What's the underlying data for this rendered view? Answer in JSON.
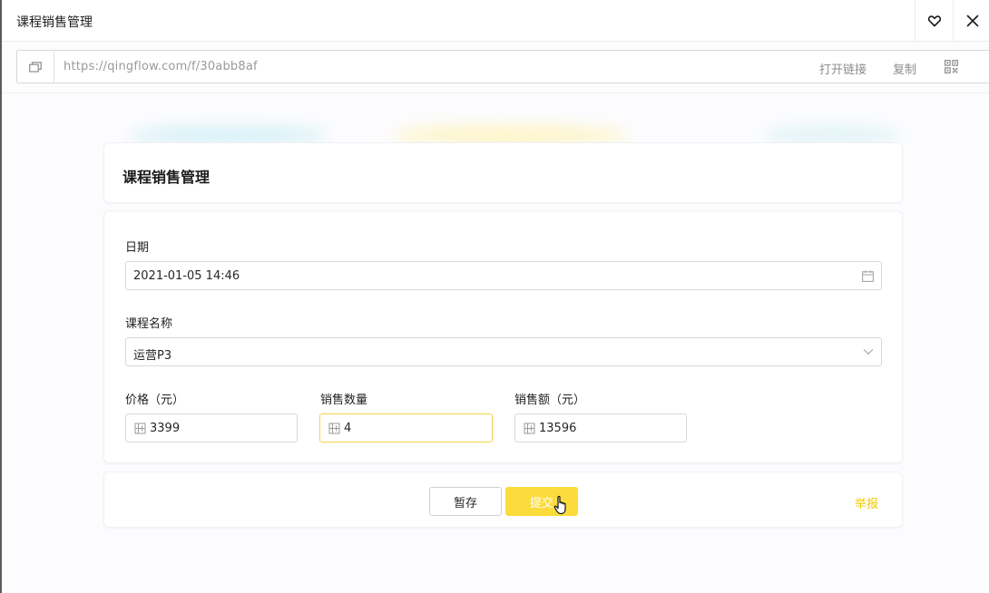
{
  "window": {
    "title": "课程销售管理"
  },
  "url_bar": {
    "url": "https://qingflow.com/f/30abb8af",
    "open_link_label": "打开链接",
    "copy_label": "复制"
  },
  "form": {
    "title": "课程销售管理",
    "fields": {
      "date": {
        "label": "日期",
        "value": "2021-01-05 14:46"
      },
      "course_name": {
        "label": "课程名称",
        "value": "运营P3"
      },
      "price": {
        "label": "价格（元）",
        "value": "3399"
      },
      "quantity": {
        "label": "销售数量",
        "value": "4"
      },
      "amount": {
        "label": "销售额（元）",
        "value": "13596"
      }
    }
  },
  "actions": {
    "save_label": "暂存",
    "submit_label": "提交",
    "report_label": "举报"
  },
  "colors": {
    "accent": "#fbdc3c",
    "report": "#f0c800"
  },
  "icons": [
    "heart-icon",
    "close-icon",
    "window-icon",
    "qr-code-icon",
    "calendar-icon",
    "chevron-down-icon",
    "number-icon",
    "hand-cursor-icon"
  ]
}
